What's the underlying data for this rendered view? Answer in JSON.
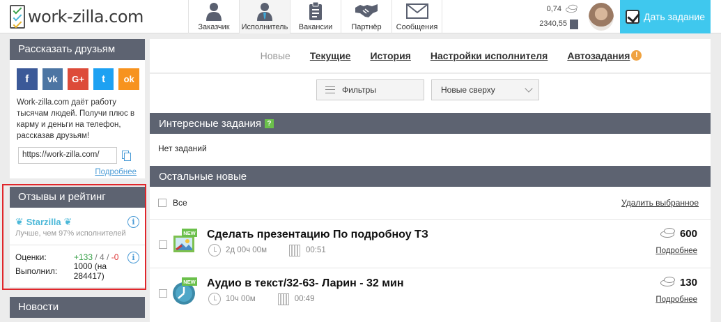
{
  "header": {
    "logo_text": "work-zilla.com",
    "nav": [
      {
        "label": "Заказчик",
        "icon": "client-person-icon"
      },
      {
        "label": "Исполнитель",
        "icon": "freelancer-person-icon"
      },
      {
        "label": "Вакансии",
        "icon": "clipboard-icon"
      },
      {
        "label": "Партнёр",
        "icon": "handshake-icon"
      },
      {
        "label": "Сообщения",
        "icon": "envelope-icon"
      }
    ],
    "balance_coins": "0,74",
    "balance_money": "2340,55",
    "give_task_label": "Дать задание"
  },
  "sidebar": {
    "share": {
      "title": "Рассказать друзьям",
      "socials": [
        {
          "label": "f",
          "color": "#3b5998",
          "icon": "facebook-icon"
        },
        {
          "label": "vk",
          "color": "#4c75a3",
          "icon": "vk-icon"
        },
        {
          "label": "G+",
          "color": "#dd4b39",
          "icon": "google-plus-icon"
        },
        {
          "label": "t",
          "color": "#1da1f2",
          "icon": "twitter-icon"
        },
        {
          "label": "ok",
          "color": "#f7931e",
          "icon": "odnoklassniki-icon"
        }
      ],
      "text": "Work-zilla.com даёт работу тысячам людей. Получи плюс в карму и деньги на телефон, рассказав друзьям!",
      "ref_link": "https://work-zilla.com/",
      "more": "Подробнее"
    },
    "rating": {
      "title": "Отзывы и рейтинг",
      "starzilla": "Starzilla",
      "better_than": "Лучше, чем 97% исполнителей",
      "ratings_label": "Оценки:",
      "positive": "+133",
      "neutral": "4",
      "negative": "-0",
      "done_label": "Выполнил:",
      "done_value": "1000 (на 284417)"
    },
    "news": {
      "title": "Новости"
    }
  },
  "main": {
    "tabs": [
      {
        "label": "Новые",
        "current": true
      },
      {
        "label": "Текущие"
      },
      {
        "label": "История"
      },
      {
        "label": "Настройки исполнителя"
      },
      {
        "label": "Автозадания",
        "badge": "!"
      }
    ],
    "filters_label": "Фильтры",
    "sort_value": "Новые сверху",
    "interesting_title": "Интересные задания",
    "interesting_badge": "?",
    "no_tasks": "Нет заданий",
    "others_title": "Остальные новые",
    "select_all": "Все",
    "delete_selected": "Удалить выбранное",
    "tasks": [
      {
        "title": "Сделать презентацию По подробноу ТЗ",
        "duration": "2д 00ч 00м",
        "time": "00:51",
        "price": "600",
        "more": "Подробнее",
        "new_badge": "NEW"
      },
      {
        "title": "Аудио в текст/32-63- Ларин - 32 мин",
        "duration": "10ч 00м",
        "time": "00:49",
        "price": "130",
        "more": "Подробнее",
        "new_badge": "NEW"
      }
    ]
  }
}
